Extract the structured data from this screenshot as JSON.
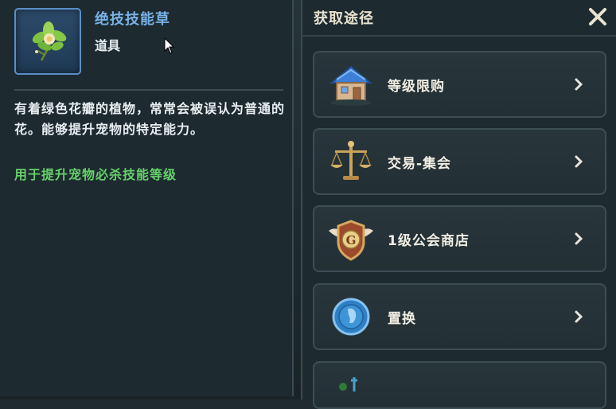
{
  "item": {
    "name": "绝技技能草",
    "type": "道具",
    "description": "有着绿色花瓣的植物，常常会被误认为普通的花。能够提升宠物的特定能力。",
    "effect": "用于提升宠物必杀技能等级",
    "icon": "herb-icon"
  },
  "acquire": {
    "title": "获取途径",
    "close_icon": "close-icon",
    "sources": [
      {
        "label": "等级限购",
        "icon": "shop-house-icon"
      },
      {
        "label": "交易-集会",
        "icon": "scales-icon"
      },
      {
        "label": "1级公会商店",
        "icon": "guild-badge-icon"
      },
      {
        "label": "置换",
        "icon": "exchange-coin-icon"
      }
    ]
  },
  "colors": {
    "item_name": "#79b2e6",
    "effect_text": "#66d06a"
  }
}
